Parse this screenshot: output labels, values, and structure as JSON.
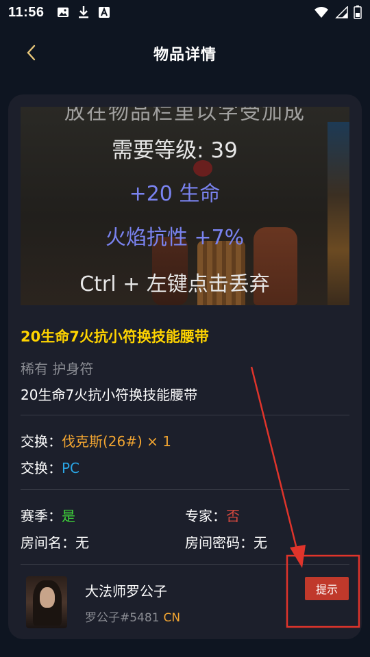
{
  "status_bar": {
    "time": "11:56",
    "left_icons": [
      "image-icon",
      "download-icon",
      "a-notification-icon"
    ],
    "right_icons": [
      "wifi-icon",
      "signal-icon",
      "battery-icon"
    ]
  },
  "header": {
    "title": "物品详情",
    "back_icon": "chevron-left-icon"
  },
  "item": {
    "image_text": {
      "top_partial": "放在物品栏里以字受加成",
      "requirement": "需要等级: 39",
      "life": "+20 生命",
      "fire_resist": "火焰抗性 +7%",
      "drop_hint": "Ctrl + 左键点击丢弃"
    },
    "title": "20生命7火抗小符换技能腰带",
    "rarity": "稀有 护身符",
    "name": "20生命7火抗小符换技能腰带"
  },
  "exchange": {
    "row1_label": "交换：",
    "row1_value": "伐克斯(26#) × 1",
    "row2_label": "交换：",
    "row2_value": "PC"
  },
  "attributes": {
    "season_label": "赛季：",
    "season_value": "是",
    "expert_label": "专家：",
    "expert_value": "否",
    "room_name_label": "房间名：",
    "room_name_value": "无",
    "room_password_label": "房间密码：",
    "room_password_value": "无"
  },
  "seller": {
    "name": "大法师罗公子",
    "id": "罗公子#5481",
    "region": "CN",
    "hint_button": "提示"
  },
  "colors": {
    "background": "#0e1521",
    "card": "#1c1f2b",
    "title_yellow": "#ffd400",
    "orange": "#f2a531",
    "blue": "#2aa6e6",
    "green": "#3fd33a",
    "red": "#d6493f",
    "annotation_red": "#e0342b"
  }
}
